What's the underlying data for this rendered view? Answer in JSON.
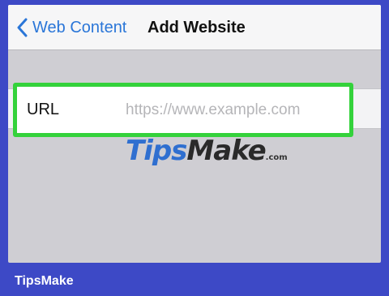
{
  "navbar": {
    "back_label": "Web Content",
    "title": "Add Website"
  },
  "form": {
    "url_label": "URL",
    "url_placeholder": "https://www.example.com",
    "url_value": ""
  },
  "watermark": {
    "tips": "Tips",
    "make": "Make",
    "com": ".com"
  },
  "footer": {
    "brand": "TipsMake"
  },
  "colors": {
    "frame_bg": "#3d49c6",
    "accent": "#2a76d8",
    "highlight_border": "#34d23b"
  },
  "icons": {
    "back": "chevron-left-icon"
  }
}
